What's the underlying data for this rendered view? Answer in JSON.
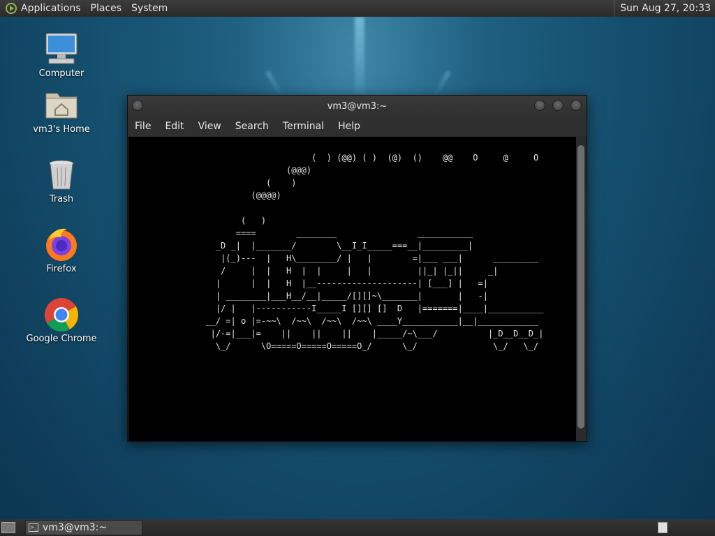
{
  "top_panel": {
    "menus": [
      "Applications",
      "Places",
      "System"
    ],
    "clock": "Sun Aug 27, 20:33"
  },
  "desktop_icons": [
    {
      "label": "Computer",
      "icon": "computer-icon"
    },
    {
      "label": "vm3's Home",
      "icon": "home-folder-icon"
    },
    {
      "label": "Trash",
      "icon": "trash-icon"
    },
    {
      "label": "Firefox",
      "icon": "firefox-icon"
    },
    {
      "label": "Google Chrome",
      "icon": "chrome-icon"
    }
  ],
  "terminal": {
    "title": "vm3@vm3:~",
    "menu": [
      "File",
      "Edit",
      "View",
      "Search",
      "Terminal",
      "Help"
    ],
    "output": "                                    (  ) (@@) ( )  (@)  ()    @@    O     @     O\n                               (@@@)\n                           (    )\n                        (@@@@)\n\n                      (   )\n                     ====        ________                ___________\n                 _D _|  |_______/        \\__I_I_____===__|_________|\n                  |(_)---  |   H\\________/ |   |        =|___ ___|      _________\n                  /     |  |   H  |  |     |   |         ||_| |_||     _|\n                 |      |  |   H  |__--------------------| [___] |   =|\n                 | ________|___H__/__|_____/[][]~\\_______|       |   -|\n                 |/ |   |-----------I_____I [][] []  D   |=======|____|___________\n               __/ =| o |=-~~\\  /~~\\  /~~\\  /~~\\ ____Y___________|__|____________\n                |/-=|___|=    ||    ||    ||    |_____/~\\___/          |_D__D__D_|\n                 \\_/      \\O=====O=====O=====O_/      \\_/               \\_/   \\_/"
  },
  "taskbar": {
    "window_button": "vm3@vm3:~"
  },
  "colors": {
    "panel": "#2e2e2e",
    "terminal_bg": "#000000",
    "terminal_fg": "#e6e6e6"
  }
}
